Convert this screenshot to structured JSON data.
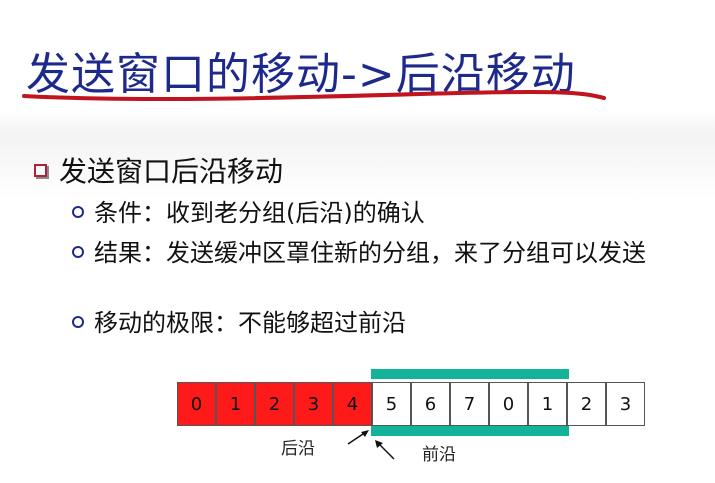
{
  "slide": {
    "title": "发送窗口的移动->后沿移动",
    "main_bullet": "发送窗口后沿移动",
    "sub_bullets": [
      "条件：收到老分组(后沿)的确认",
      "结果：发送缓冲区罩住新的分组，来了分组可以发送",
      "移动的极限：不能够超过前沿"
    ]
  },
  "diagram": {
    "cells": [
      "0",
      "1",
      "2",
      "3",
      "4",
      "5",
      "6",
      "7",
      "0",
      "1",
      "2",
      "3"
    ],
    "colors": {
      "acked": "#ff1a1a",
      "window_bar": "#13b39a",
      "unsent": "#ffffff"
    },
    "acked_count": 5,
    "window_size": 5,
    "rear_label": "后沿",
    "front_label": "前沿"
  }
}
